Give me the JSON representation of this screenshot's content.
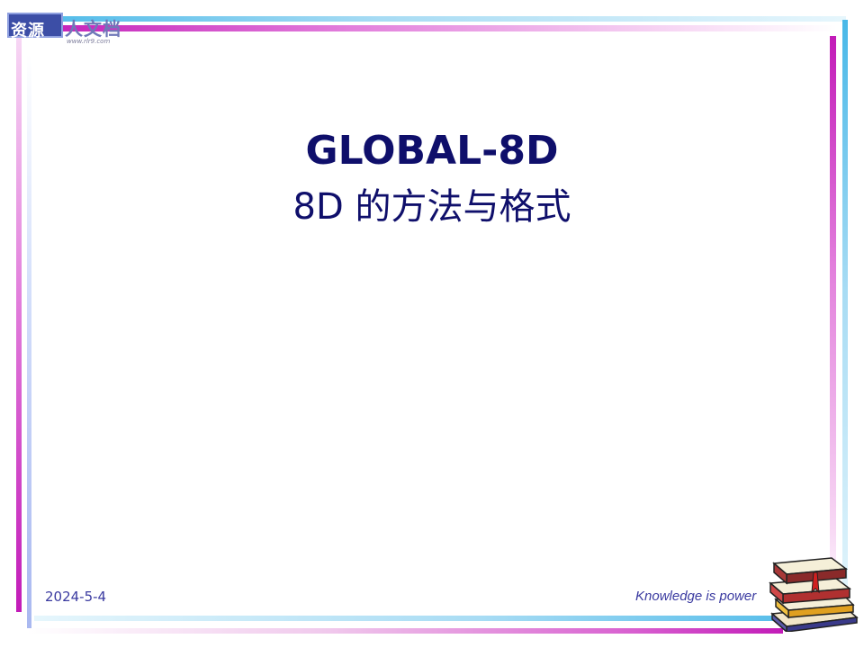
{
  "logo": {
    "text_boxed": "资源",
    "text_main": "人文档",
    "url": "www.rlr9.com"
  },
  "slide": {
    "title": "GLOBAL-8D",
    "subtitle": "8D 的方法与格式"
  },
  "footer": {
    "date": "2024-5-4",
    "tagline": "Knowledge is power"
  },
  "colors": {
    "title": "#0f0f6b",
    "footer_text": "#3a3aa0",
    "accent_magenta": "#c21bb8",
    "accent_cyan": "#48b8e8"
  },
  "icons": {
    "books": "books-icon"
  }
}
